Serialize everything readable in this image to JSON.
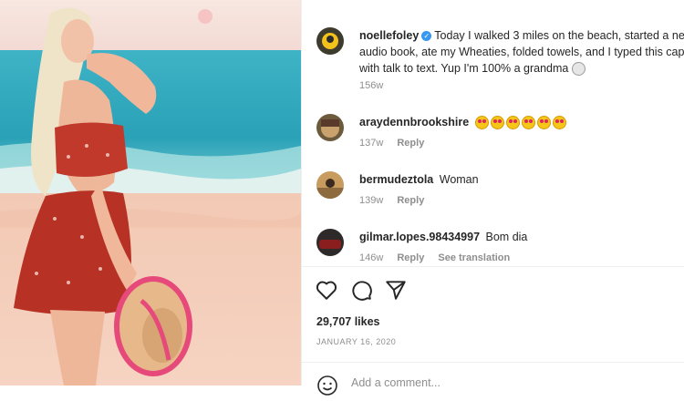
{
  "post": {
    "author": "noellefoley",
    "caption": "Today I walked 3 miles on the beach, started a new audio book, ate my Wheaties, folded towels, and I typed this caption with talk to text. Yup I'm 100% a grandma",
    "caption_time": "156w"
  },
  "comments": [
    {
      "user": "araydennbrookshire",
      "text": "",
      "time": "137w",
      "reply": "Reply",
      "emoji_count": 6
    },
    {
      "user": "bermudeztola",
      "text": "Woman",
      "time": "139w",
      "reply": "Reply"
    },
    {
      "user": "gilmar.lopes.98434997",
      "text": "Bom dia",
      "time": "146w",
      "reply": "Reply",
      "see_translation": "See translation"
    }
  ],
  "likes": "29,707 likes",
  "date": "JANUARY 16, 2020",
  "add_comment": {
    "placeholder": "Add a comment..."
  },
  "icons": [
    "heart-icon",
    "comment-icon",
    "share-icon",
    "verified-icon",
    "smile-icon"
  ],
  "colors": {
    "verified": "#3897f0",
    "text": "#262626",
    "muted": "#8e8e8e"
  }
}
